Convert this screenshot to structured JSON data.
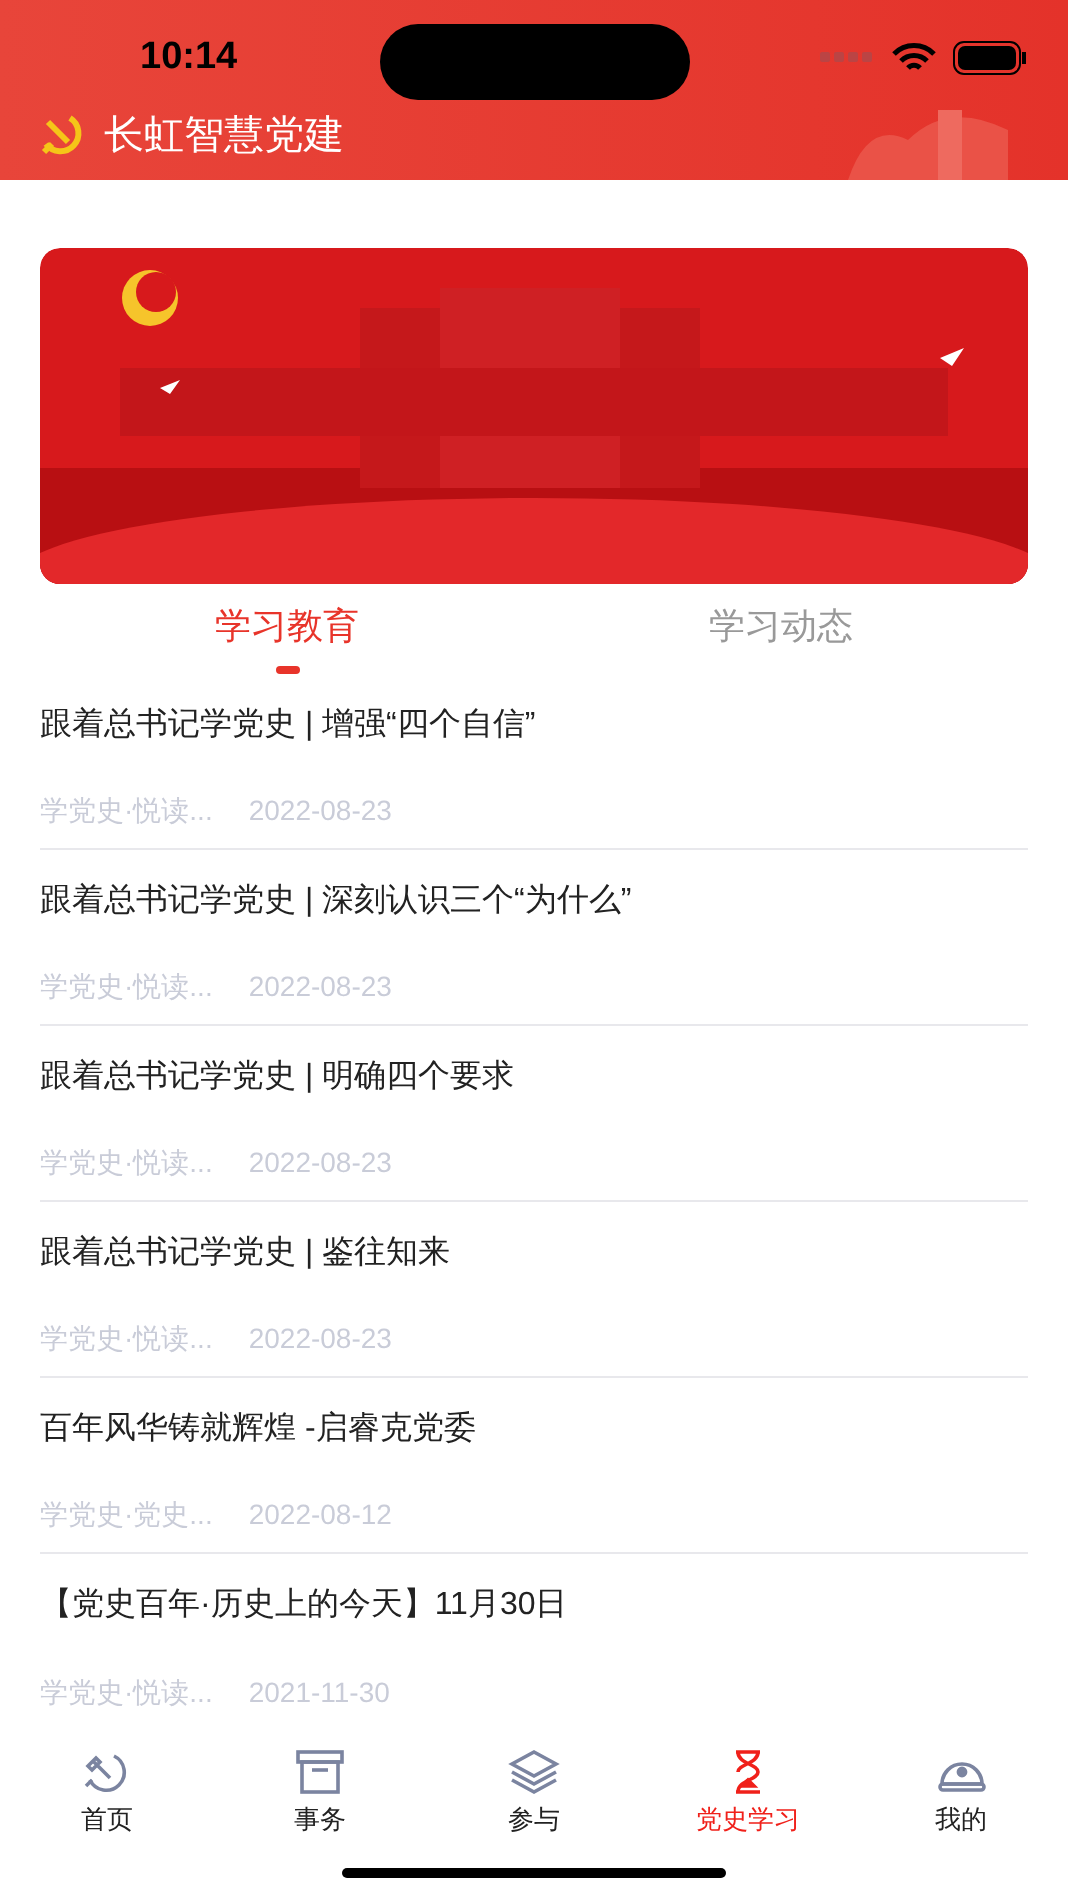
{
  "status_bar": {
    "time": "10:14"
  },
  "header": {
    "title": "长虹智慧党建"
  },
  "tabs": [
    {
      "label": "学习教育",
      "selected": true
    },
    {
      "label": "学习动态",
      "selected": false
    }
  ],
  "articles": [
    {
      "title": "跟着总书记学党史 | 增强“四个自信”",
      "source": "学党史·悦读...",
      "date": "2022-08-23"
    },
    {
      "title": "跟着总书记学党史 | 深刻认识三个“为什么”",
      "source": "学党史·悦读...",
      "date": "2022-08-23"
    },
    {
      "title": "跟着总书记学党史 | 明确四个要求",
      "source": "学党史·悦读...",
      "date": "2022-08-23"
    },
    {
      "title": "跟着总书记学党史 | 鉴往知来",
      "source": "学党史·悦读...",
      "date": "2022-08-23"
    },
    {
      "title": "百年风华铸就辉煌 -启睿克党委",
      "source": "学党史·党史...",
      "date": "2022-08-12"
    },
    {
      "title": "【党史百年·历史上的今天】11月30日",
      "source": "学党史·悦读...",
      "date": "2021-11-30"
    }
  ],
  "nav": [
    {
      "label": "首页",
      "selected": false
    },
    {
      "label": "事务",
      "selected": false
    },
    {
      "label": "参与",
      "selected": false
    },
    {
      "label": "党史学习",
      "selected": true
    },
    {
      "label": "我的",
      "selected": false
    }
  ]
}
